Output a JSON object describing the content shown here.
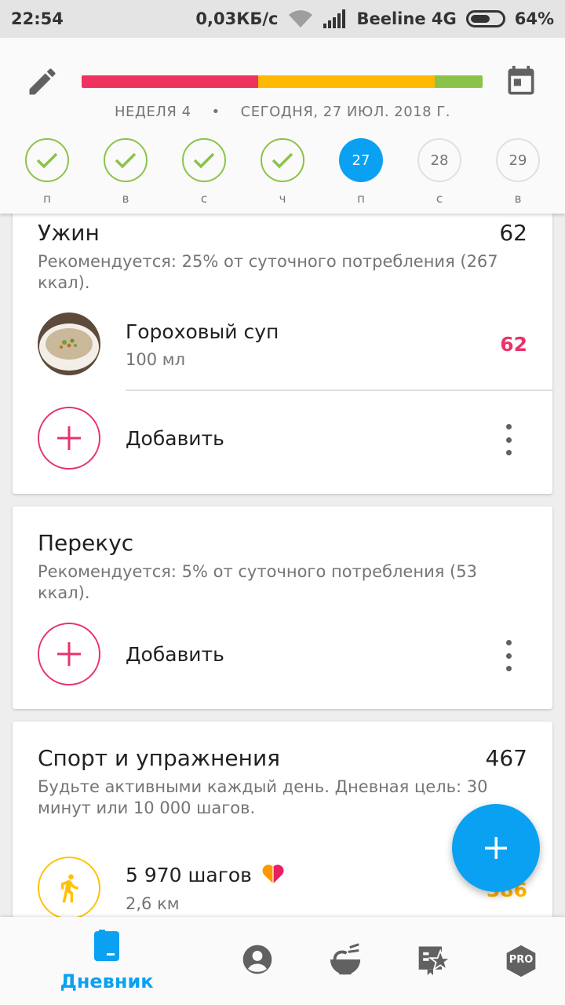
{
  "status_bar": {
    "time": "22:54",
    "speed": "0,03КБ/с",
    "carrier": "Beeline 4G",
    "battery": "64%",
    "battery_level": 0.64
  },
  "header": {
    "week": "НЕДЕЛЯ 4",
    "separator": "•",
    "today": "СЕГОДНЯ, 27 ИЮЛ. 2018 Г.",
    "progress": [
      {
        "fraction": 0.44,
        "color": "#f0335e"
      },
      {
        "fraction": 0.44,
        "color": "#ffb900"
      },
      {
        "fraction": 0.12,
        "color": "#8bc34a"
      }
    ],
    "days": [
      {
        "label": "п",
        "state": "done",
        "text": ""
      },
      {
        "label": "в",
        "state": "done",
        "text": ""
      },
      {
        "label": "с",
        "state": "done",
        "text": ""
      },
      {
        "label": "ч",
        "state": "done",
        "text": ""
      },
      {
        "label": "п",
        "state": "today",
        "text": "27"
      },
      {
        "label": "с",
        "state": "future",
        "text": "28"
      },
      {
        "label": "в",
        "state": "future",
        "text": "29"
      }
    ]
  },
  "dinner": {
    "title": "Ужин",
    "total": "62",
    "desc": "Рекомендуется: 25% от суточного потребления (267 ккал).",
    "item": {
      "name": "Гороховый суп",
      "amount": "100 мл",
      "kcal": "62"
    },
    "add_label": "Добавить"
  },
  "snack": {
    "title": "Перекус",
    "desc": "Рекомендуется: 5% от суточного потребления (53 ккал).",
    "add_label": "Добавить"
  },
  "sport": {
    "title": "Спорт и упражнения",
    "total": "467",
    "desc": "Будьте активными каждый день. Дневная цель: 30 минут или 10 000 шагов.",
    "item": {
      "name": "5 970 шагов",
      "distance": "2,6 км",
      "kcal": "386"
    }
  },
  "nav": {
    "diary_label": "Дневник",
    "pro_label": "PRO"
  },
  "colors": {
    "accent": "#0aa1f2",
    "pink": "#e8336b",
    "green": "#8bc34a",
    "yellow": "#ffc107"
  }
}
